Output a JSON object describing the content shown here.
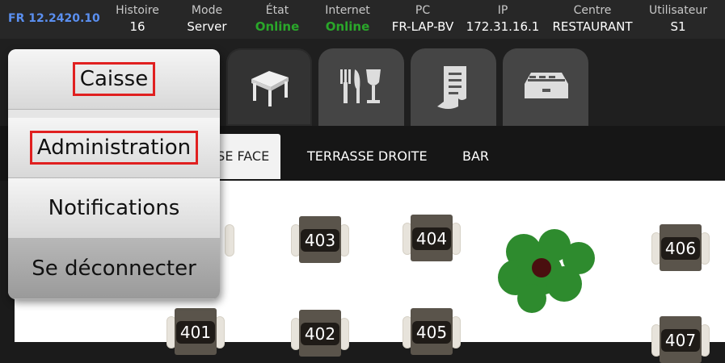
{
  "status": {
    "version": "FR 12.2420.10",
    "items": [
      {
        "label": "Histoire",
        "value": "16"
      },
      {
        "label": "Mode",
        "value": "Server"
      },
      {
        "label": "État",
        "value": "Online"
      },
      {
        "label": "Internet",
        "value": "Online"
      },
      {
        "label": "PC",
        "value": "FR-LAP-BV"
      },
      {
        "label": "IP",
        "value": "172.31.16.1"
      },
      {
        "label": "Centre",
        "value": "RESTAURANT"
      },
      {
        "label": "Utilisateur",
        "value": "S1"
      }
    ],
    "online_color": "#2aa72a"
  },
  "nav_tabs": [
    {
      "icon": "table-icon",
      "active": true
    },
    {
      "icon": "cutlery-wine-icon",
      "active": false
    },
    {
      "icon": "receipt-icon",
      "active": false
    },
    {
      "icon": "cash-drawer-icon",
      "active": false
    }
  ],
  "floor_tabs": [
    {
      "label": "SSE FACE",
      "active": true
    },
    {
      "label": "TERRASSE DROITE",
      "active": false
    },
    {
      "label": "BAR",
      "active": false
    }
  ],
  "tables": [
    "403",
    "404",
    "406",
    "401",
    "402",
    "405",
    "407"
  ],
  "menu": {
    "items": [
      "Caisse",
      "Administration",
      "Notifications",
      "Se déconnecter"
    ],
    "highlight_color": "#e02020"
  }
}
